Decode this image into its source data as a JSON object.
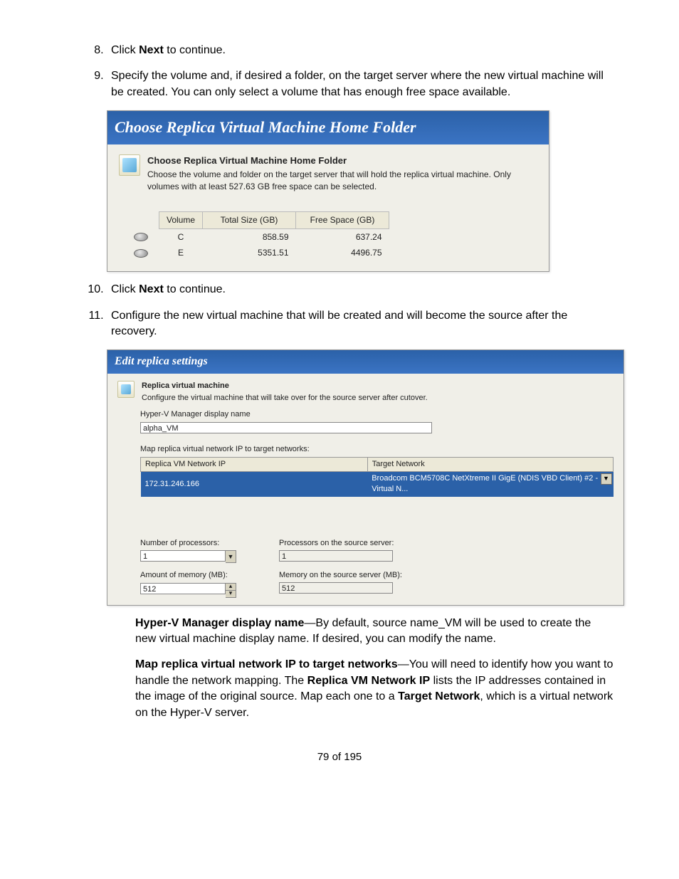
{
  "steps": {
    "s8": {
      "prefix": "Click ",
      "bold": "Next",
      "suffix": " to continue."
    },
    "s9": "Specify the volume and, if desired a folder, on the target server where the new virtual machine will be created. You can only select a volume that has enough free space available.",
    "s10": {
      "prefix": "Click ",
      "bold": "Next",
      "suffix": " to continue."
    },
    "s11": "Configure the new virtual machine that will be created and will become the source after the recovery."
  },
  "shot1": {
    "title": "Choose Replica Virtual Machine Home Folder",
    "panel_heading": "Choose Replica Virtual Machine Home Folder",
    "panel_desc": "Choose the volume and folder on the target server that will hold the replica virtual machine. Only volumes with at least 527.63 GB free space can be selected.",
    "cols": {
      "vol": "Volume",
      "size": "Total Size (GB)",
      "free": "Free Space (GB)"
    },
    "rows": [
      {
        "vol": "C",
        "size": "858.59",
        "free": "637.24"
      },
      {
        "vol": "E",
        "size": "5351.51",
        "free": "4496.75"
      }
    ]
  },
  "shot2": {
    "title": "Edit replica settings",
    "panel_heading": "Replica virtual machine",
    "panel_desc": "Configure the virtual machine that will take over for the source server after cutover.",
    "hv_name_label": "Hyper-V Manager display name",
    "hv_name_value": "alpha_VM",
    "map_label": "Map replica virtual network IP to target networks:",
    "net_cols": {
      "ip": "Replica VM Network IP",
      "target": "Target Network"
    },
    "net_row": {
      "ip": "172.31.246.166",
      "target": "Broadcom BCM5708C NetXtreme II GigE (NDIS VBD Client) #2 - Virtual N..."
    },
    "proc_label": "Number of processors:",
    "proc_value": "1",
    "proc_src_label": "Processors on the source server:",
    "proc_src_value": "1",
    "mem_label": "Amount of memory (MB):",
    "mem_value": "512",
    "mem_src_label": "Memory on the source server (MB):",
    "mem_src_value": "512"
  },
  "desc": {
    "d1_bold": "Hyper-V Manager display name",
    "d1_text": "—By default, source name_VM will be used to create the new virtual machine display name. If desired, you can modify the name.",
    "d2_bold": "Map replica virtual network IP to target networks",
    "d2_text_a": "—You will need to identify how you want to handle the network mapping. The ",
    "d2_bold2": "Replica VM Network IP",
    "d2_text_b": " lists the IP addresses contained in the image of the original source. Map each one to a ",
    "d2_bold3": "Target Network",
    "d2_text_c": ", which is a virtual network on the Hyper-V server."
  },
  "footer": "79 of 195"
}
